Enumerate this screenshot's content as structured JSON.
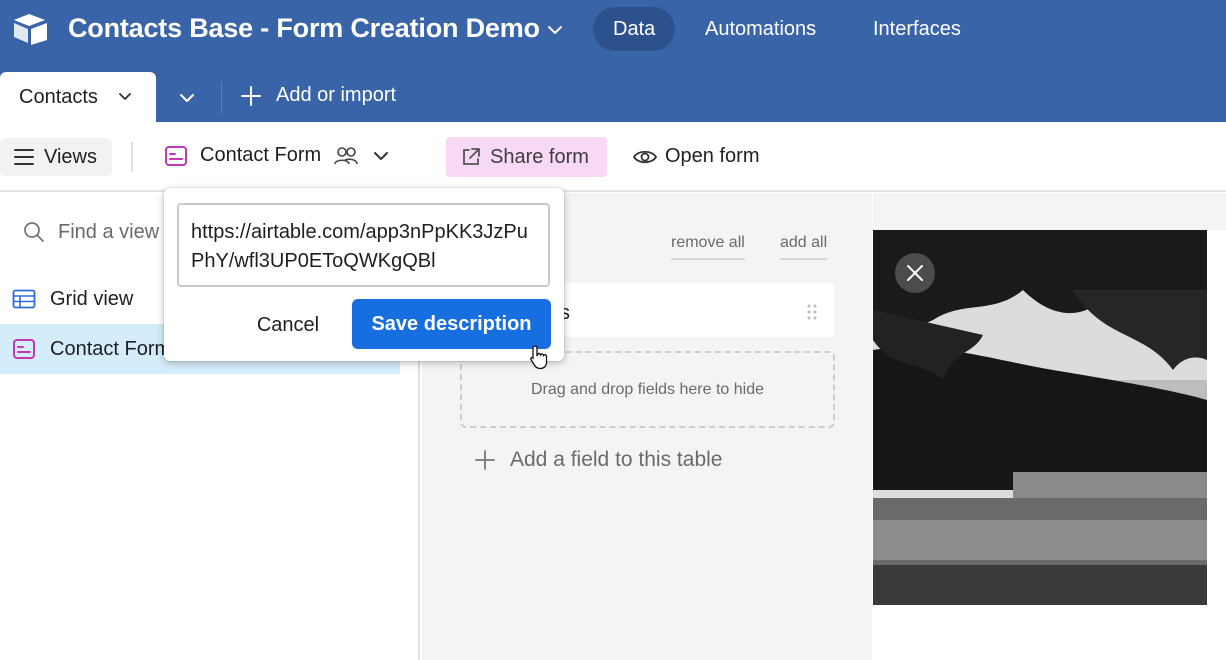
{
  "app": {
    "base_title": "Contacts Base - Form Creation Demo",
    "nav": {
      "data": "Data",
      "automations": "Automations",
      "interfaces": "Interfaces"
    }
  },
  "tables": {
    "active_tab": "Contacts",
    "add_import": "Add or import"
  },
  "toolbar": {
    "views": "Views",
    "view_name": "Contact Form",
    "share_form": "Share form",
    "open_form": "Open form"
  },
  "sidebar": {
    "search_placeholder": "Find a view",
    "items": [
      {
        "label": "Grid view",
        "icon": "grid-icon"
      },
      {
        "label": "Contact Form",
        "icon": "form-icon"
      }
    ]
  },
  "fields_panel": {
    "remove_all": "remove all",
    "add_all": "add all",
    "field_label_fragment": "s",
    "dropzone_text": "Drag and drop fields here to hide",
    "add_field": "Add a field to this table"
  },
  "popover": {
    "url_value": "https://airtable.com/app3nPpKK3JzPuPhY/wfl3UP0EToQWKgQBl",
    "cancel": "Cancel",
    "save": "Save description"
  },
  "colors": {
    "appbar": "#3a64a8",
    "nav_active": "#2d518c",
    "share_bg": "#f7d8f5",
    "form_icon": "#c238b5",
    "grid_icon": "#2e6ed6",
    "primary": "#166ee1",
    "selected_row": "#d5ecfb"
  }
}
